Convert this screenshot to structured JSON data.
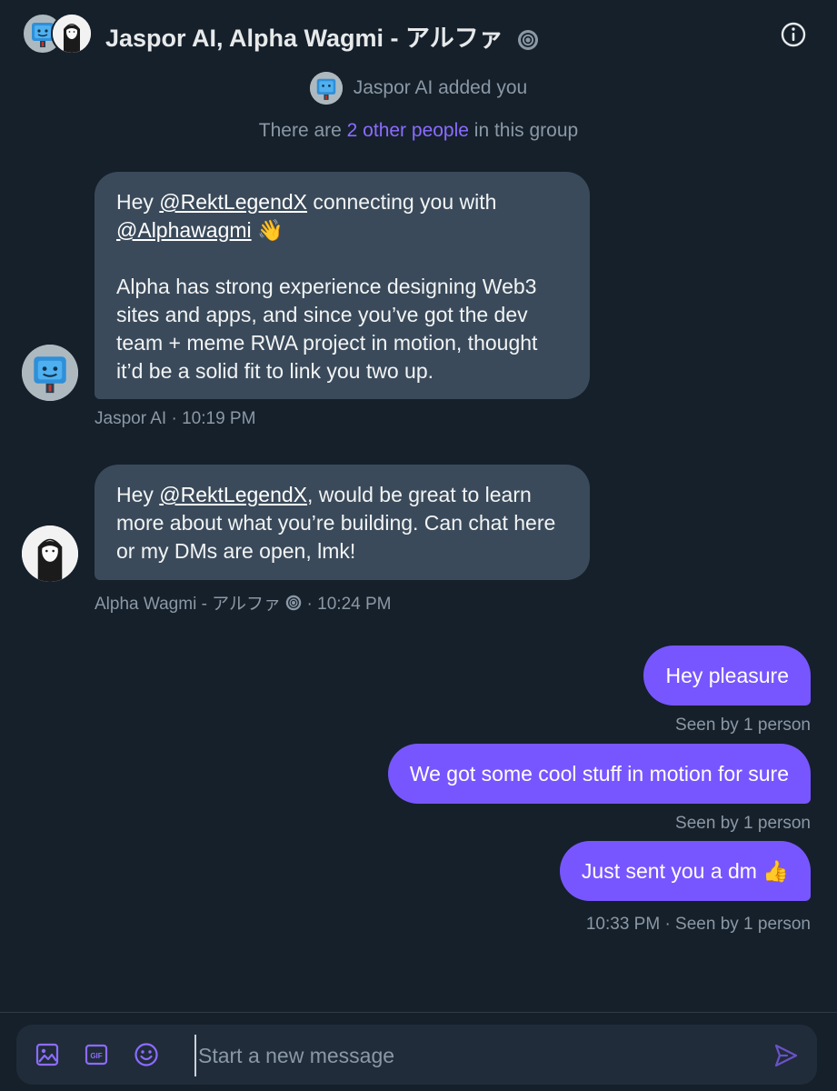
{
  "header": {
    "title": "Jaspor AI, Alpha Wagmi - アルファ",
    "info_icon": "info-circle-icon"
  },
  "notices": {
    "added_text": "Jaspor AI added you",
    "group_prefix": "There are ",
    "group_link": "2 other people",
    "group_suffix": " in this group"
  },
  "messages_in": [
    {
      "greeting": "Hey ",
      "mention1": "@RektLegendX",
      "mid": " connecting you with ",
      "mention2": "@Alphawagmi",
      "emoji": " 👋",
      "body": "Alpha has strong experience designing Web3 sites and apps, and since you’ve got the dev team + meme RWA project in motion, thought it’d be a solid fit to link you two up.",
      "sender": "Jaspor AI",
      "time": " · 10:19 PM"
    },
    {
      "greeting": "Hey ",
      "mention1": "@RektLegendX",
      "rest": ", would be great to learn more about what you’re building. Can chat here or my DMs are open, lmk!",
      "sender": "Alpha Wagmi - アルファ ",
      "time": " · 10:24 PM"
    }
  ],
  "messages_out": [
    {
      "text": "Hey pleasure",
      "status": "Seen by 1 person"
    },
    {
      "text": "We got some cool stuff in motion for sure",
      "status": "Seen by 1 person"
    },
    {
      "text": "Just sent you a dm 👍",
      "status": "10:33 PM · Seen by 1 person"
    }
  ],
  "composer": {
    "placeholder": "Start a new message",
    "tools": [
      "image-icon",
      "gif-icon",
      "emoji-icon"
    ],
    "send_icon": "send-icon"
  },
  "colors": {
    "background": "#15202b",
    "accent": "#7856ff",
    "bubble_in": "#3a4a5a",
    "muted_text": "#8b98a5"
  }
}
